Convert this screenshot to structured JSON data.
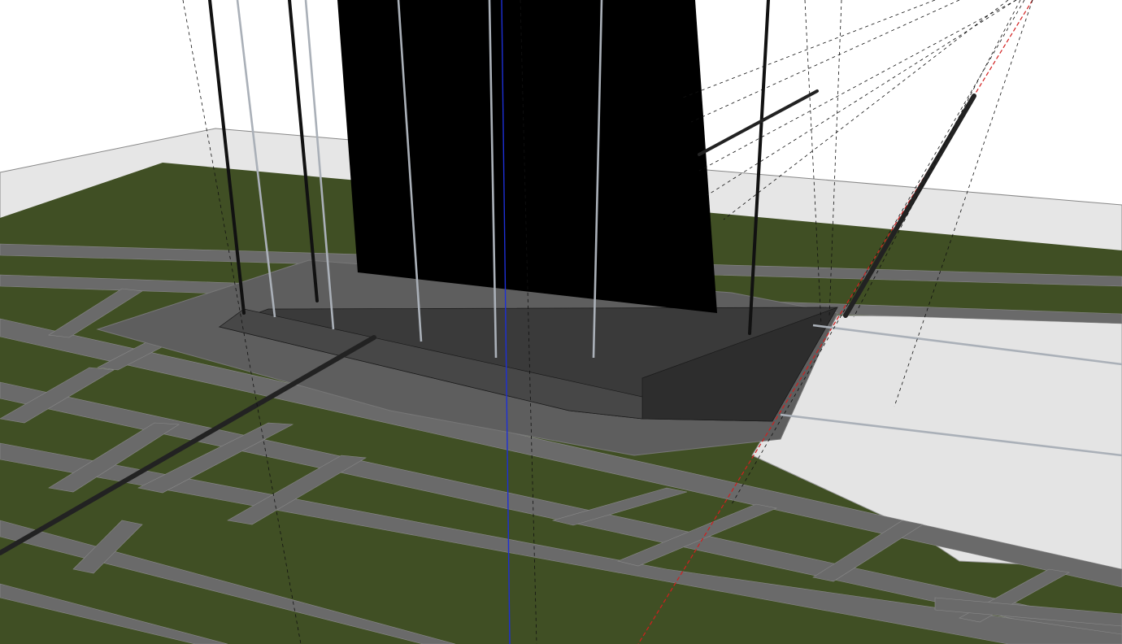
{
  "colors": {
    "sky": "#ffffff",
    "ground_slab": "#e6e6e6",
    "grass": "#404f24",
    "taxiway": "#6a6a6a",
    "apron": "#5e5e5e",
    "landside": "#e4e4e4",
    "tower_mass": "#000000",
    "axis_blue": "#1d2fd6",
    "axis_red": "#d21e1e",
    "guide_line": "#111111"
  }
}
